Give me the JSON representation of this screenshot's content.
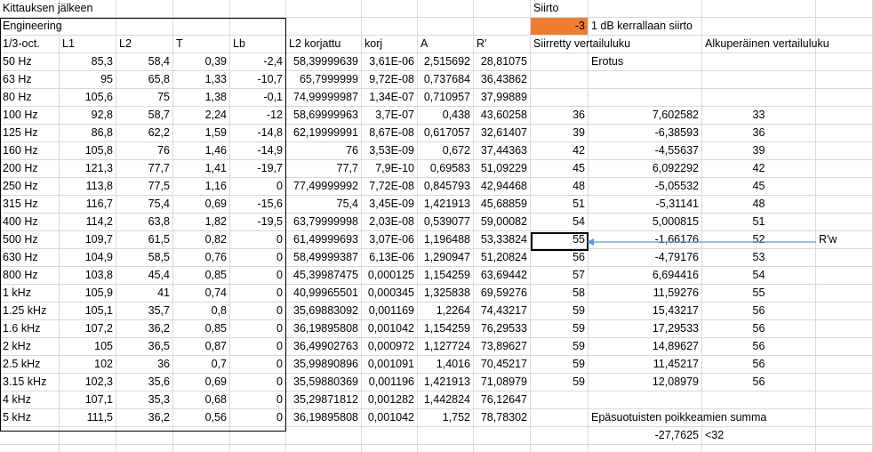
{
  "sheet": {
    "title": "Kittauksen jälkeen",
    "section": "Engineering",
    "siirto_label": "Siirto",
    "siirto_value": "-3",
    "siirto_note": "1 dB kerrallaan siirto",
    "col_headers": [
      "1/3-oct.",
      "L1",
      "L2",
      "T",
      "Lb",
      "L2 korjattu",
      "korj",
      "A",
      "R'"
    ],
    "col_siirretty": "Siirretty vertailuluku",
    "col_alkuperainen": "Alkuperäinen vertailuluku",
    "col_erotus": "Erotus",
    "rows": [
      {
        "f": "50 Hz",
        "L1": "85,3",
        "L2": "58,4",
        "T": "0,39",
        "Lb": "-2,4",
        "L2k": "58,39999639",
        "korj": "3,61E-06",
        "A": "2,515692",
        "R": "28,81075",
        "sv": "",
        "er": "",
        "av": ""
      },
      {
        "f": "63 Hz",
        "L1": "95",
        "L2": "65,8",
        "T": "1,33",
        "Lb": "-10,7",
        "L2k": "65,7999999",
        "korj": "9,72E-08",
        "A": "0,737684",
        "R": "36,43862",
        "sv": "",
        "er": "",
        "av": ""
      },
      {
        "f": "80 Hz",
        "L1": "105,6",
        "L2": "75",
        "T": "1,38",
        "Lb": "-0,1",
        "L2k": "74,99999987",
        "korj": "1,34E-07",
        "A": "0,710957",
        "R": "37,99889",
        "sv": "",
        "er": "",
        "av": ""
      },
      {
        "f": "100 Hz",
        "L1": "92,8",
        "L2": "58,7",
        "T": "2,24",
        "Lb": "-12",
        "L2k": "58,69999963",
        "korj": "3,7E-07",
        "A": "0,438",
        "R": "43,60258",
        "sv": "36",
        "er": "7,602582",
        "av": "33"
      },
      {
        "f": "125 Hz",
        "L1": "86,8",
        "L2": "62,2",
        "T": "1,59",
        "Lb": "-14,8",
        "L2k": "62,19999991",
        "korj": "8,67E-08",
        "A": "0,617057",
        "R": "32,61407",
        "sv": "39",
        "er": "-6,38593",
        "av": "36"
      },
      {
        "f": "160 Hz",
        "L1": "105,8",
        "L2": "76",
        "T": "1,46",
        "Lb": "-14,9",
        "L2k": "76",
        "korj": "3,53E-09",
        "A": "0,672",
        "R": "37,44363",
        "sv": "42",
        "er": "-4,55637",
        "av": "39"
      },
      {
        "f": "200 Hz",
        "L1": "121,3",
        "L2": "77,7",
        "T": "1,41",
        "Lb": "-19,7",
        "L2k": "77,7",
        "korj": "7,9E-10",
        "A": "0,69583",
        "R": "51,09229",
        "sv": "45",
        "er": "6,092292",
        "av": "42"
      },
      {
        "f": "250 Hz",
        "L1": "113,8",
        "L2": "77,5",
        "T": "1,16",
        "Lb": "0",
        "L2k": "77,49999992",
        "korj": "7,72E-08",
        "A": "0,845793",
        "R": "42,94468",
        "sv": "48",
        "er": "-5,05532",
        "av": "45"
      },
      {
        "f": "315 Hz",
        "L1": "116,7",
        "L2": "75,4",
        "T": "0,69",
        "Lb": "-15,6",
        "L2k": "75,4",
        "korj": "3,45E-09",
        "A": "1,421913",
        "R": "45,68859",
        "sv": "51",
        "er": "-5,31141",
        "av": "48"
      },
      {
        "f": "400 Hz",
        "L1": "114,2",
        "L2": "63,8",
        "T": "1,82",
        "Lb": "-19,5",
        "L2k": "63,79999998",
        "korj": "2,03E-08",
        "A": "0,539077",
        "R": "59,00082",
        "sv": "54",
        "er": "5,000815",
        "av": "51"
      },
      {
        "f": "500 Hz",
        "L1": "109,7",
        "L2": "61,5",
        "T": "0,82",
        "Lb": "0",
        "L2k": "61,49999693",
        "korj": "3,07E-06",
        "A": "1,196488",
        "R": "53,33824",
        "sv": "55",
        "er": "-1,66176",
        "av": "52"
      },
      {
        "f": "630 Hz",
        "L1": "104,9",
        "L2": "58,5",
        "T": "0,76",
        "Lb": "0",
        "L2k": "58,49999387",
        "korj": "6,13E-06",
        "A": "1,290947",
        "R": "51,20824",
        "sv": "56",
        "er": "-4,79176",
        "av": "53"
      },
      {
        "f": "800 Hz",
        "L1": "103,8",
        "L2": "45,4",
        "T": "0,85",
        "Lb": "0",
        "L2k": "45,39987475",
        "korj": "0,000125",
        "A": "1,154259",
        "R": "63,69442",
        "sv": "57",
        "er": "6,694416",
        "av": "54"
      },
      {
        "f": "1 kHz",
        "L1": "105,9",
        "L2": "41",
        "T": "0,74",
        "Lb": "0",
        "L2k": "40,99965501",
        "korj": "0,000345",
        "A": "1,325838",
        "R": "69,59276",
        "sv": "58",
        "er": "11,59276",
        "av": "55"
      },
      {
        "f": "1.25 kHz",
        "L1": "105,1",
        "L2": "35,7",
        "T": "0,8",
        "Lb": "0",
        "L2k": "35,69883092",
        "korj": "0,001169",
        "A": "1,2264",
        "R": "74,43217",
        "sv": "59",
        "er": "15,43217",
        "av": "56"
      },
      {
        "f": "1.6 kHz",
        "L1": "107,2",
        "L2": "36,2",
        "T": "0,85",
        "Lb": "0",
        "L2k": "36,19895808",
        "korj": "0,001042",
        "A": "1,154259",
        "R": "76,29533",
        "sv": "59",
        "er": "17,29533",
        "av": "56"
      },
      {
        "f": "2 kHz",
        "L1": "105",
        "L2": "36,5",
        "T": "0,87",
        "Lb": "0",
        "L2k": "36,49902763",
        "korj": "0,000972",
        "A": "1,127724",
        "R": "73,89627",
        "sv": "59",
        "er": "14,89627",
        "av": "56"
      },
      {
        "f": "2.5 kHz",
        "L1": "102",
        "L2": "36",
        "T": "0,7",
        "Lb": "0",
        "L2k": "35,99890896",
        "korj": "0,001091",
        "A": "1,4016",
        "R": "70,45217",
        "sv": "59",
        "er": "11,45217",
        "av": "56"
      },
      {
        "f": "3.15 kHz",
        "L1": "102,3",
        "L2": "35,6",
        "T": "0,69",
        "Lb": "0",
        "L2k": "35,59880369",
        "korj": "0,001196",
        "A": "1,421913",
        "R": "71,08979",
        "sv": "59",
        "er": "12,08979",
        "av": "56"
      },
      {
        "f": "4 kHz",
        "L1": "107,1",
        "L2": "35,3",
        "T": "0,68",
        "Lb": "0",
        "L2k": "35,29871812",
        "korj": "0,001282",
        "A": "1,442824",
        "R": "76,12647",
        "sv": "",
        "er": "",
        "av": ""
      },
      {
        "f": "5 kHz",
        "L1": "111,5",
        "L2": "36,2",
        "T": "0,56",
        "Lb": "0",
        "L2k": "36,19895808",
        "korj": "0,001042",
        "A": "1,752",
        "R": "78,78302",
        "sv": "",
        "er": "Epäsuotuisten poikkeamien summa",
        "av": ""
      }
    ],
    "sum_value": "-27,7625",
    "sum_limit": "<32",
    "rw_label": "R'w",
    "accent_color": "#ed7d31",
    "arrow_color": "#5b9bd5"
  }
}
